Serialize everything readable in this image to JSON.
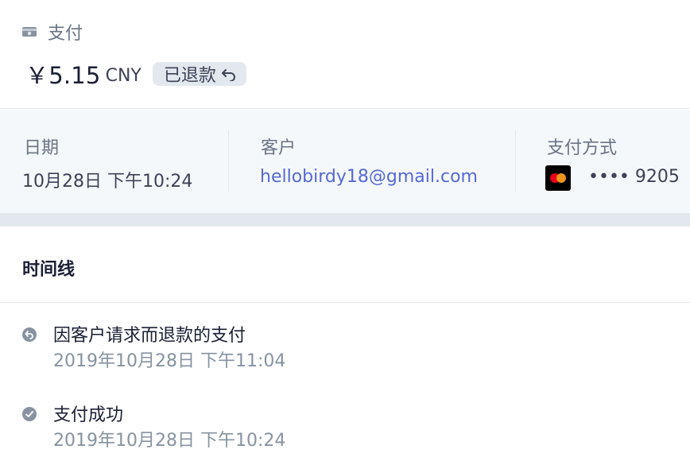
{
  "payment": {
    "label": "支付",
    "amount": "￥5.15",
    "currency": "CNY",
    "status_badge": "已退款"
  },
  "details": {
    "date": {
      "label": "日期",
      "value": "10月28日 下午10:24"
    },
    "customer": {
      "label": "客户",
      "value": "hellobirdy18@gmail.com"
    },
    "payment_method": {
      "label": "支付方式",
      "card_brand": "mastercard-icon",
      "card_number": "•••• 9205"
    }
  },
  "timeline": {
    "title": "时间线",
    "events": [
      {
        "icon": "refund-icon",
        "title": "因客户请求而退款的支付",
        "time": "2019年10月28日 下午11:04"
      },
      {
        "icon": "check-circle-icon",
        "title": "支付成功",
        "time": "2019年10月28日 下午10:24"
      }
    ]
  },
  "colors": {
    "link": "#5469d4",
    "muted": "#697386",
    "badge_bg": "#e3e8ee",
    "details_bg": "#f5f8fb"
  }
}
